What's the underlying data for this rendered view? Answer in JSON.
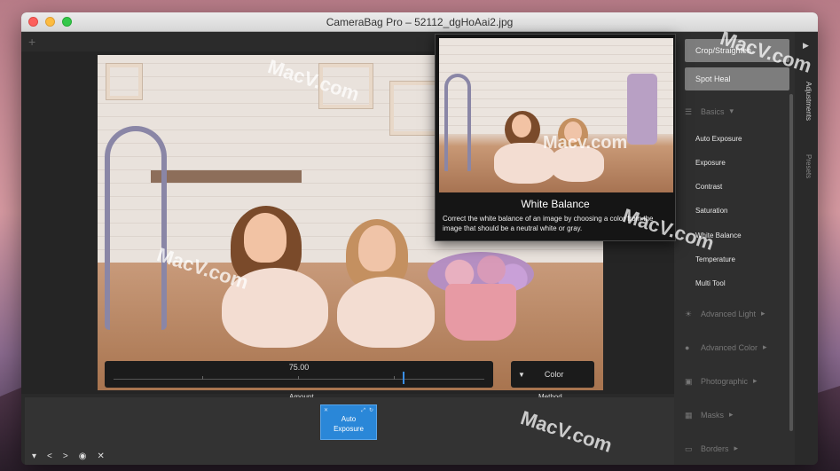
{
  "window": {
    "title": "CameraBag Pro – 52112_dgHoAai2.jpg"
  },
  "toolbar": {
    "add_icon": "+"
  },
  "slider": {
    "value": "75.00",
    "label": "Amount",
    "position_fraction": 0.78
  },
  "method": {
    "value": "Color",
    "label": "Method"
  },
  "bottom": {
    "auto_tile_label_1": "Auto",
    "auto_tile_label_2": "Exposure",
    "controls": [
      "▾",
      "<",
      ">",
      "◉",
      "✕"
    ]
  },
  "sidebar": {
    "crop_button": "Crop/Straighten",
    "spot_heal_button": "Spot Heal",
    "sections": {
      "basics": "Basics",
      "advanced_light": "Advanced Light",
      "advanced_color": "Advanced Color",
      "photographic": "Photographic",
      "masks": "Masks",
      "borders": "Borders"
    },
    "basics_items": [
      "Auto Exposure",
      "Exposure",
      "Contrast",
      "Saturation",
      "White Balance",
      "Temperature",
      "Multi Tool"
    ]
  },
  "vtabs": {
    "adjustments": "Adjustments",
    "presets": "Presets"
  },
  "tooltip": {
    "title": "White Balance",
    "description": "Correct the white balance of an image by choosing a color from the image that should be a neutral white or gray."
  },
  "watermarks": [
    "MacV.com",
    "MacV.com",
    "MacV.com",
    "Macv.com",
    "MacV.com",
    "MacV.com"
  ],
  "colors": {
    "accent": "#2a87d8",
    "panel": "#2f2f2f",
    "button": "#7d7d7d"
  }
}
